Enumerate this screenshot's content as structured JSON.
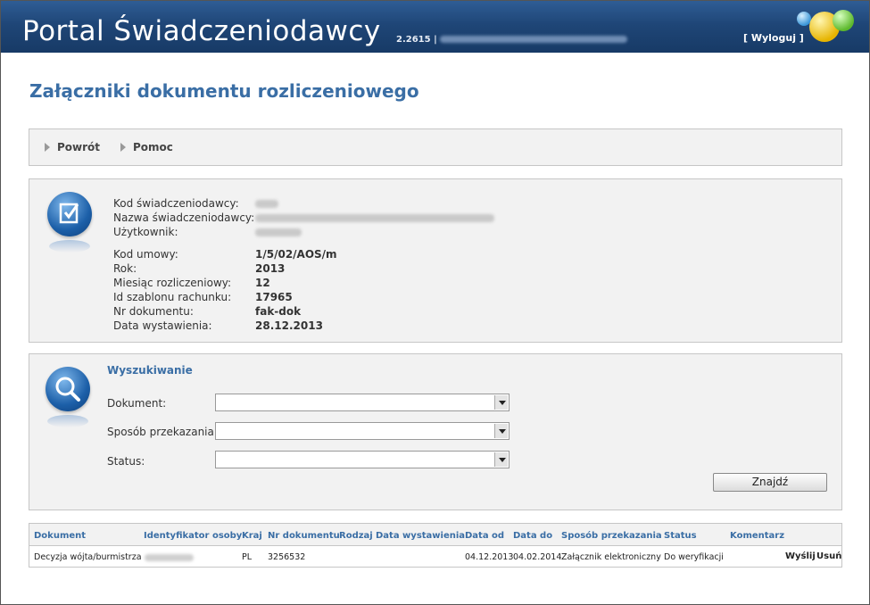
{
  "header": {
    "title": "Portal Świadczeniodawcy",
    "version": "2.2615 |",
    "logout_label": "[ Wyloguj ]"
  },
  "page_title": "Załączniki dokumentu rozliczeniowego",
  "nav": {
    "back_label": "Powrót",
    "help_label": "Pomoc"
  },
  "info": {
    "provider_code_label": "Kod świadczeniodawcy:",
    "provider_name_label": "Nazwa świadczeniodawcy:",
    "user_label": "Użytkownik:",
    "contract_code_label": "Kod umowy:",
    "contract_code": "1/5/02/AOS/m",
    "year_label": "Rok:",
    "year": "2013",
    "month_label": "Miesiąc rozliczeniowy:",
    "month": "12",
    "template_id_label": "Id szablonu rachunku:",
    "template_id": "17965",
    "doc_no_label": "Nr dokumentu:",
    "doc_no": "fak-dok",
    "issue_date_label": "Data wystawienia:",
    "issue_date": "28.12.2013"
  },
  "search": {
    "title": "Wyszukiwanie",
    "document_label": "Dokument:",
    "document_value": "",
    "transfer_label": "Sposób przekazania:",
    "transfer_value": "",
    "status_label": "Status:",
    "status_value": "",
    "find_label": "Znajdź"
  },
  "table": {
    "headers": {
      "document": "Dokument",
      "person_id": "Identyfikator osoby",
      "country": "Kraj",
      "doc_no": "Nr dokumentu",
      "kind": "Rodzaj",
      "issue_date": "Data wystawienia",
      "date_from": "Data od",
      "date_to": "Data do",
      "transfer": "Sposób przekazania",
      "status": "Status",
      "comment": "Komentarz"
    },
    "rows": [
      {
        "document": "Decyzja wójta/burmistrza",
        "country": "PL",
        "doc_no": "3256532",
        "kind": "",
        "issue_date": "",
        "date_from": "04.12.2013",
        "date_to": "04.02.2014",
        "transfer": "Załącznik elektroniczny",
        "status": "Do weryfikacji",
        "comment": "",
        "send_label": "Wyślij",
        "delete_label": "Usuń"
      }
    ]
  }
}
